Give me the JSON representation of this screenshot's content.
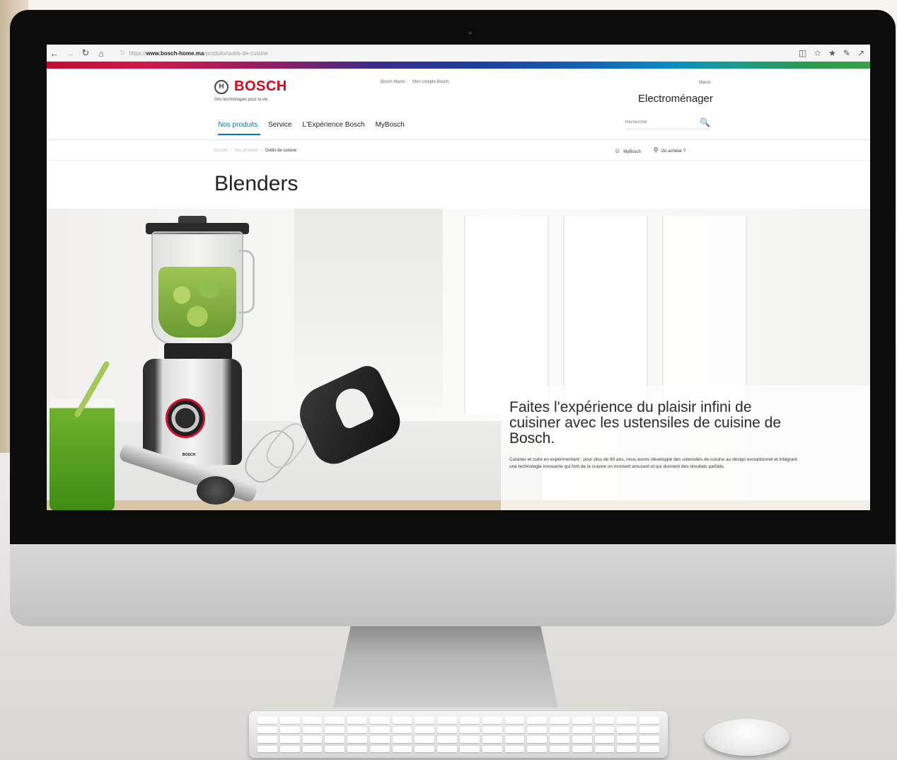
{
  "browser": {
    "url_prefix": "https://",
    "url_host": "www.bosch-home.ma",
    "url_path": "/produits/outils-de-cuisine"
  },
  "header": {
    "brand": "BOSCH",
    "tagline": "Des technologies pour la vie",
    "top_links": [
      "Bosch Maroc",
      "Mon compte Bosch"
    ],
    "country": "Maroc",
    "site_type": "Electroménager",
    "nav": [
      "Nos produits",
      "Service",
      "L'Expérience Bosch",
      "MyBosch"
    ],
    "search_placeholder": "Rechercher"
  },
  "breadcrumb": {
    "items": [
      "Accueil",
      "Nos produits"
    ],
    "current": "Outils de cuisine"
  },
  "utility": {
    "mybosch": "MyBosch",
    "where_to_buy": "Où acheter ?"
  },
  "page": {
    "title": "Blenders"
  },
  "hero": {
    "headline": "Faites l'expérience du plaisir infini de cuisiner avec les ustensiles de cuisine de Bosch.",
    "body": "Cuisiner et cuire en expérimentant : pour plus de 60 ans, nous avons développé des ustensiles de cuisine au design exceptionnel et intégrant une technologie innovante qui font de la cuisine un moment amusant et qui donnent des résultats parfaits.",
    "product_label": "BOSCH"
  },
  "colors": {
    "brand_red": "#e2001a",
    "nav_active": "#007bc0"
  }
}
